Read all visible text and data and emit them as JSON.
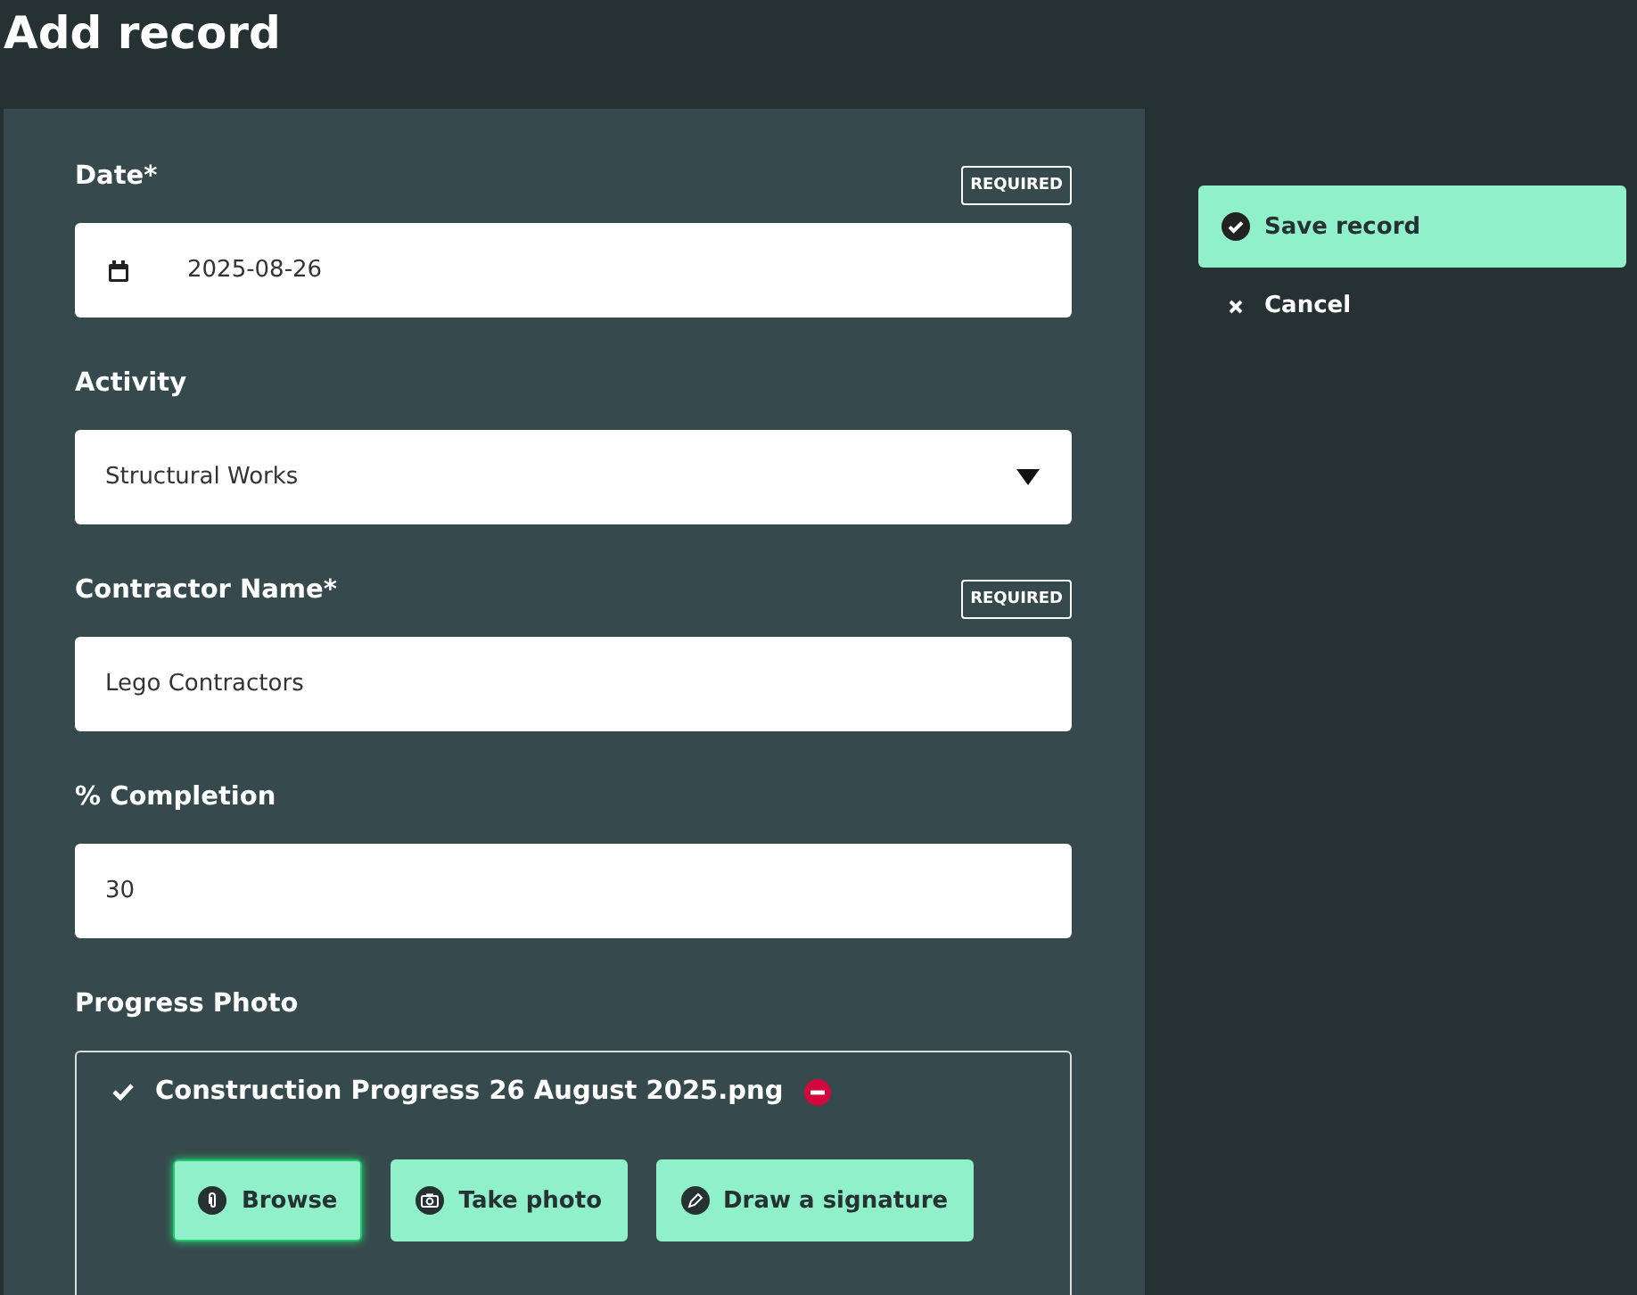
{
  "page": {
    "title": "Add record"
  },
  "fields": [
    {
      "kind": "date",
      "label": "Date*",
      "required_badge": "REQUIRED",
      "value": "2025-08-26"
    },
    {
      "kind": "select",
      "label": "Activity",
      "value": "Structural Works"
    },
    {
      "kind": "text",
      "label": "Contractor Name*",
      "required_badge": "REQUIRED",
      "value": "Lego Contractors"
    },
    {
      "kind": "text",
      "label": "% Completion",
      "value": "30"
    }
  ],
  "photo": {
    "label": "Progress Photo",
    "file_name": "Construction Progress 26 August 2025.png",
    "uploaded": true,
    "buttons": [
      {
        "kind": "browse",
        "label": "Browse",
        "focused": true
      },
      {
        "kind": "camera",
        "label": "Take photo",
        "focused": false
      },
      {
        "kind": "signature",
        "label": "Draw a signature",
        "focused": false
      }
    ]
  },
  "actions": [
    {
      "kind": "save",
      "label": "Save record"
    },
    {
      "kind": "cancel",
      "label": "Cancel"
    }
  ]
}
